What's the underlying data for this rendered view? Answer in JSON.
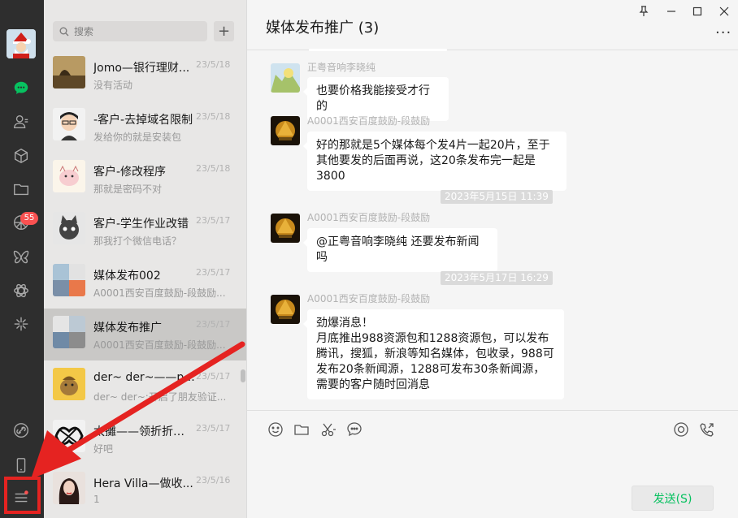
{
  "window": {
    "controls": {
      "pin": "⊥",
      "minimize": "—",
      "maximize": "□",
      "close": "×"
    }
  },
  "rail": {
    "badge_count": "55",
    "icons": [
      "avatar",
      "chat-icon",
      "contacts-icon",
      "cube-icon",
      "folder-icon",
      "moments-icon",
      "butterfly-icon",
      "atom-icon",
      "sparkle-icon",
      "link-icon",
      "phone-icon",
      "menu-icon"
    ]
  },
  "list": {
    "search_placeholder": "搜索",
    "add_label": "+",
    "conversations": [
      {
        "name": "Jomo—银行理财...",
        "date": "23/5/18",
        "preview": "没有活动",
        "active": false
      },
      {
        "name": "-客户-去掉域名限制",
        "date": "23/5/18",
        "preview": "发给你的就是安装包",
        "active": false
      },
      {
        "name": "客户-修改程序",
        "date": "23/5/18",
        "preview": "那就是密码不对",
        "active": false
      },
      {
        "name": "客户-学生作业改错",
        "date": "23/5/17",
        "preview": "那我打个微信电话？",
        "active": false
      },
      {
        "name": "媒体发布002",
        "date": "23/5/17",
        "preview": "A0001西安百度鼓励-段鼓励...",
        "active": false
      },
      {
        "name": "媒体发布推广",
        "date": "23/5/17",
        "preview": "A0001西安百度鼓励-段鼓励...",
        "active": true
      },
      {
        "name": "der~ der~——p...",
        "date": "23/5/17",
        "preview": "der~ der~:开启了朋友验证...",
        "active": false
      },
      {
        "name": "太攤——领折折试...",
        "date": "23/5/17",
        "preview": "好吧",
        "active": false
      },
      {
        "name": "Hera Villa—做收...",
        "date": "23/5/16",
        "preview": "1",
        "active": false
      }
    ]
  },
  "chat": {
    "title": "媒体发布推广 (3)",
    "more_label": "···",
    "messages": [
      {
        "type": "msg",
        "sender": "正粤音响李晓纯",
        "text": "也要价格我能接受才行的"
      },
      {
        "type": "msg",
        "sender": "A0001西安百度鼓励-段鼓励",
        "text": "好的那就是5个媒体每个发4片一起20片，至于其他要发的后面再说，这20条发布完一起是3800"
      },
      {
        "type": "time",
        "text": "2023年5月15日 11:39"
      },
      {
        "type": "msg",
        "sender": "A0001西安百度鼓励-段鼓励",
        "text": "@正粤音响李晓纯 还要发布新闻吗"
      },
      {
        "type": "time",
        "text": "2023年5月17日 16:29"
      },
      {
        "type": "msg",
        "sender": "A0001西安百度鼓励-段鼓励",
        "text": "劲爆消息！\n月底推出988资源包和1288资源包，可以发布腾讯，搜狐，新浪等知名媒体，包收录，988可发布20条新闻源，1288可发布30条新闻源，需要的客户随时回消息"
      }
    ],
    "toolbar_icons": [
      "emoji-icon",
      "folder-icon",
      "scissors-icon",
      "chat-history-icon",
      "live-icon",
      "voice-call-icon"
    ],
    "send_label": "发送(S)"
  },
  "colors": {
    "rail": "#2e2e2e",
    "list_bg": "#e8e7e6",
    "active_conv": "#c9c8c6",
    "chat_bg": "#f5f5f5",
    "wechat_green": "#07c160",
    "badge_red": "#fa5151",
    "annotation_red": "#e52321"
  }
}
